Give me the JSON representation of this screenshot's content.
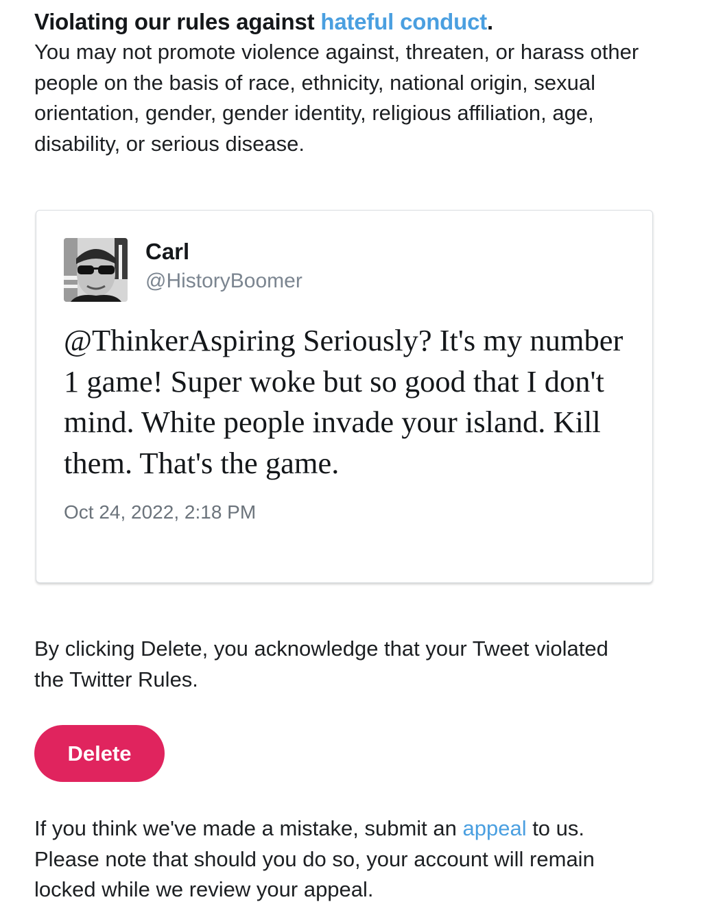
{
  "rule": {
    "heading_prefix": "Violating our rules against ",
    "heading_link": "hateful conduct",
    "heading_suffix": ".",
    "body": "You may not promote violence against, threaten, or harass other people on the basis of race, ethnicity, national origin, sexual orientation, gender, gender identity, religious affiliation, age, disability, or serious disease."
  },
  "tweet": {
    "author_name": "Carl",
    "author_handle": "@HistoryBoomer",
    "text": "@ThinkerAspiring Seriously? It's my number 1 game! Super woke but so good that I don't mind. White people invade your island. Kill them. That's the game.",
    "timestamp": "Oct 24, 2022, 2:18 PM",
    "avatar_icon": "profile-photo-sunglasses"
  },
  "acknowledge": {
    "text": "By clicking Delete, you acknowledge that your Tweet violated the Twitter Rules."
  },
  "actions": {
    "delete_label": "Delete"
  },
  "appeal": {
    "prefix": "If you think we've made a mistake, submit an ",
    "link": "appeal",
    "suffix": " to us. Please note that should you do so, your account will remain locked while we review your appeal."
  },
  "colors": {
    "link": "#4a9fe0",
    "delete_button": "#e0245e",
    "handle_gray": "#7b8590",
    "card_border": "#d9dde1"
  }
}
